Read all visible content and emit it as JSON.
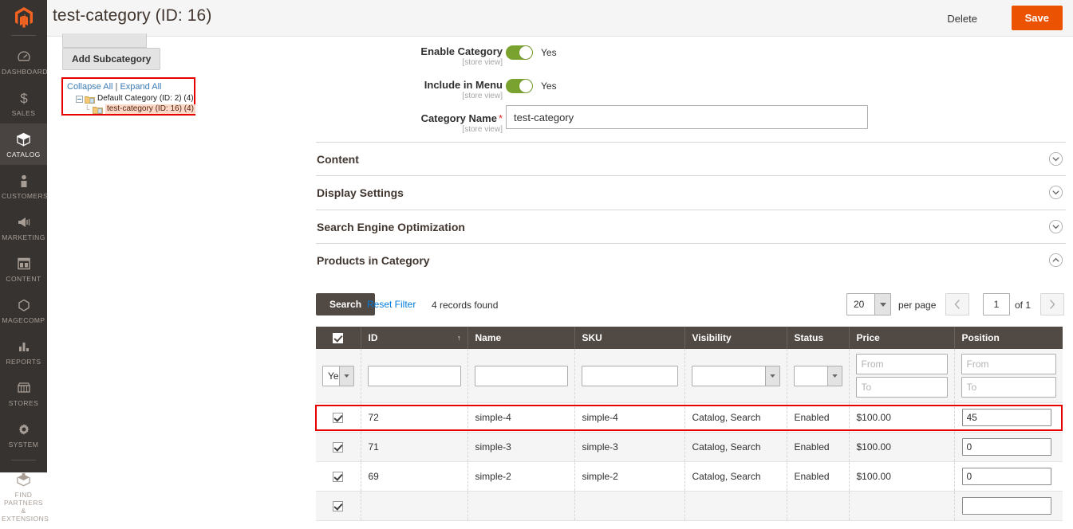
{
  "rail": {
    "logo_icon": "magento-logo-icon",
    "items": [
      {
        "label": "DASHBOARD",
        "icon": "dashboard-icon",
        "active": false
      },
      {
        "label": "SALES",
        "icon": "dollar-icon",
        "active": false
      },
      {
        "label": "CATALOG",
        "icon": "box-icon",
        "active": true
      },
      {
        "label": "CUSTOMERS",
        "icon": "person-icon",
        "active": false
      },
      {
        "label": "MARKETING",
        "icon": "megaphone-icon",
        "active": false
      },
      {
        "label": "CONTENT",
        "icon": "layout-icon",
        "active": false
      },
      {
        "label": "MAGECOMP",
        "icon": "hexagon-icon",
        "active": false
      },
      {
        "label": "REPORTS",
        "icon": "bar-chart-icon",
        "active": false
      },
      {
        "label": "STORES",
        "icon": "storefront-icon",
        "active": false
      },
      {
        "label": "SYSTEM",
        "icon": "gear-icon",
        "active": false
      },
      {
        "label": "FIND PARTNERS\n& EXTENSIONS",
        "icon": "extension-icon",
        "active": false
      }
    ]
  },
  "header": {
    "title": "test-category (ID: 16)",
    "delete_label": "Delete",
    "save_label": "Save",
    "save_color": "#eb5202"
  },
  "left_panel": {
    "add_subcategory_label": "Add Subcategory",
    "collapse_all_label": "Collapse All",
    "separator": "|",
    "expand_all_label": "Expand All",
    "highlight_color": "#e60000",
    "tree": [
      {
        "label": "Default Category (ID: 2) (4)",
        "level": 0,
        "expanded": true,
        "selected": false
      },
      {
        "label": "test-category (ID: 16) (4)",
        "level": 1,
        "expanded": false,
        "selected": true
      }
    ]
  },
  "form": {
    "enable_category": {
      "label": "Enable Category",
      "scope": "[store view]",
      "value": "Yes",
      "on": true
    },
    "include_in_menu": {
      "label": "Include in Menu",
      "scope": "[store view]",
      "value": "Yes",
      "on": true
    },
    "category_name": {
      "label": "Category Name",
      "scope": "[store view]",
      "required_marker": "*",
      "value": "test-category",
      "placeholder": ""
    }
  },
  "sections": [
    {
      "title": "Content",
      "expanded": false,
      "icon": "chevron-down-icon"
    },
    {
      "title": "Display Settings",
      "expanded": false,
      "icon": "chevron-down-icon"
    },
    {
      "title": "Search Engine Optimization",
      "expanded": false,
      "icon": "chevron-down-icon"
    },
    {
      "title": "Products in Category",
      "expanded": true,
      "icon": "chevron-up-icon"
    }
  ],
  "grid_toolbar": {
    "search_label": "Search",
    "reset_filter_label": "Reset Filter",
    "records_found": "4 records found",
    "per_page_value": "20",
    "per_page_label": "per page",
    "page_value": "1",
    "page_total": "of 1",
    "prev_icon": "chevron-left-icon",
    "next_icon": "chevron-right-icon"
  },
  "grid": {
    "columns": [
      {
        "key": "checkbox",
        "label": ""
      },
      {
        "key": "id",
        "label": "ID",
        "sorted": "asc"
      },
      {
        "key": "name",
        "label": "Name"
      },
      {
        "key": "sku",
        "label": "SKU"
      },
      {
        "key": "visibility",
        "label": "Visibility"
      },
      {
        "key": "status",
        "label": "Status"
      },
      {
        "key": "price",
        "label": "Price"
      },
      {
        "key": "position",
        "label": "Position"
      }
    ],
    "header_checkbox_checked": true,
    "filters": {
      "checkbox_select": "Yes",
      "id": "",
      "name": "",
      "sku": "",
      "visibility": "",
      "status": "",
      "price_from_placeholder": "From",
      "price_to_placeholder": "To",
      "price_from": "",
      "price_to": "",
      "position_from_placeholder": "From",
      "position_to_placeholder": "To",
      "position_from": "",
      "position_to": ""
    },
    "rows": [
      {
        "checked": true,
        "id": "72",
        "name": "simple-4",
        "sku": "simple-4",
        "visibility": "Catalog, Search",
        "status": "Enabled",
        "price": "$100.00",
        "position": "45",
        "highlighted": true
      },
      {
        "checked": true,
        "id": "71",
        "name": "simple-3",
        "sku": "simple-3",
        "visibility": "Catalog, Search",
        "status": "Enabled",
        "price": "$100.00",
        "position": "0",
        "highlighted": false
      },
      {
        "checked": true,
        "id": "69",
        "name": "simple-2",
        "sku": "simple-2",
        "visibility": "Catalog, Search",
        "status": "Enabled",
        "price": "$100.00",
        "position": "0",
        "highlighted": false
      },
      {
        "checked": true,
        "id": "",
        "name": "",
        "sku": "",
        "visibility": "",
        "status": "",
        "price": "",
        "position": "",
        "highlighted": false
      }
    ]
  }
}
